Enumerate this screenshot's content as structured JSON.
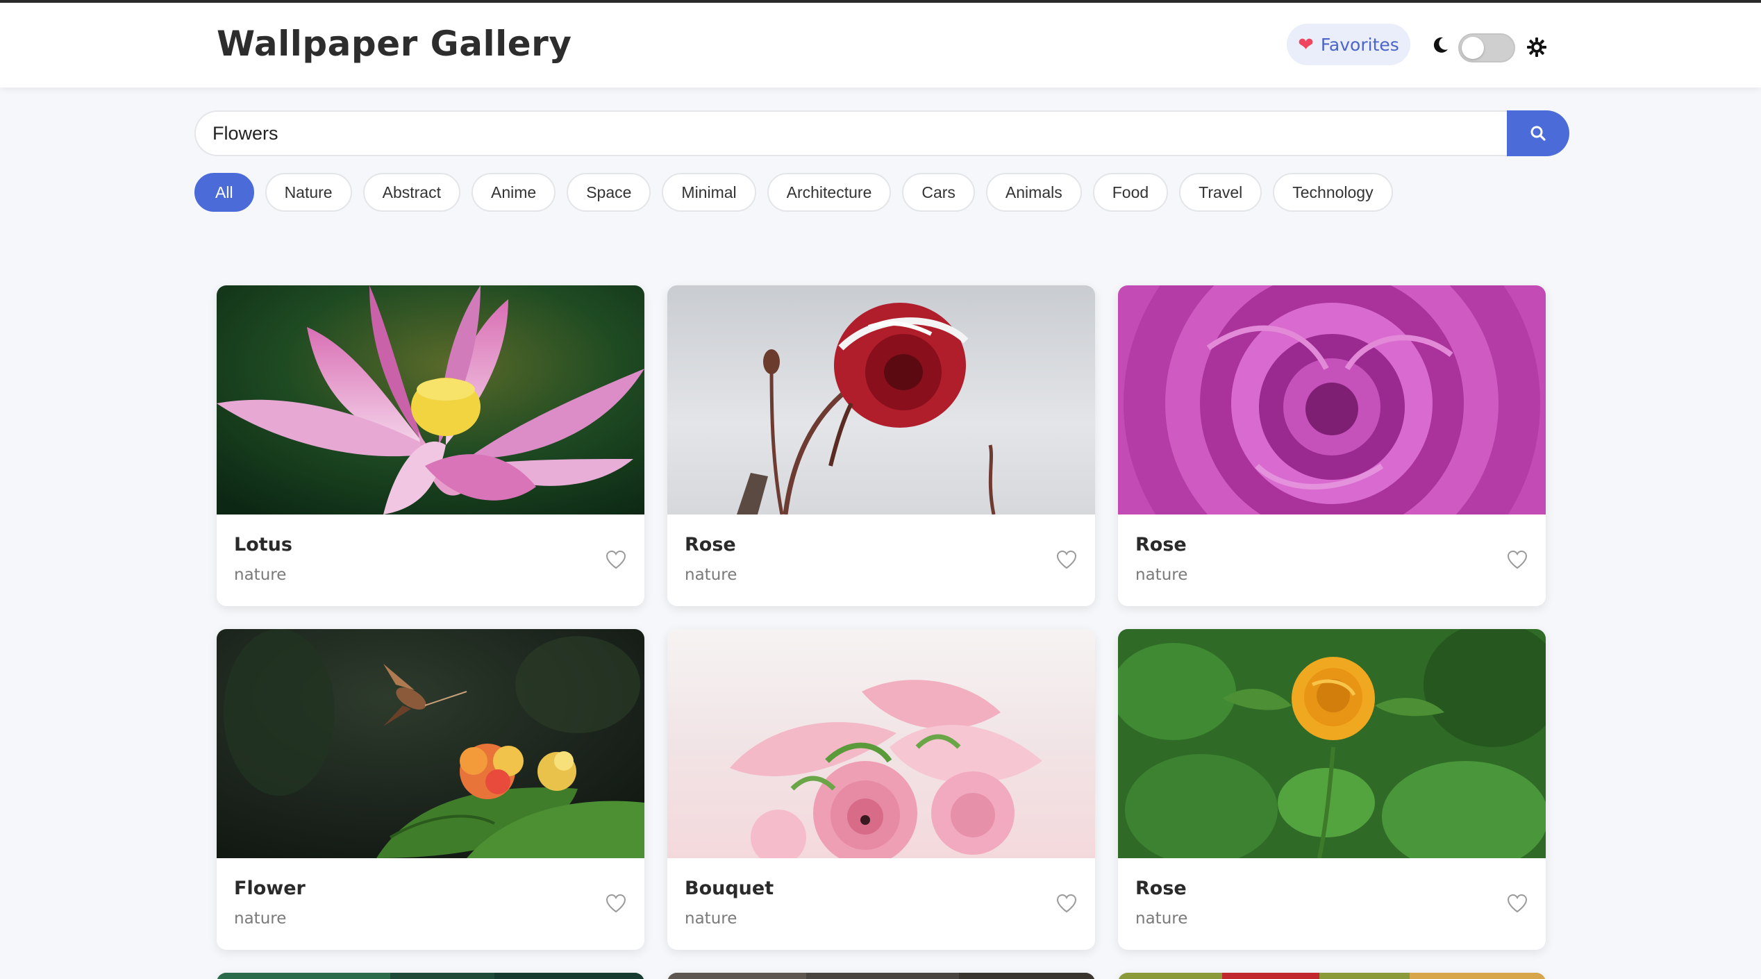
{
  "header": {
    "title": "Wallpaper Gallery",
    "favorites_label": "Favorites"
  },
  "search": {
    "value": "Flowers"
  },
  "filters": [
    "All",
    "Nature",
    "Abstract",
    "Anime",
    "Space",
    "Minimal",
    "Architecture",
    "Cars",
    "Animals",
    "Food",
    "Travel",
    "Technology"
  ],
  "active_filter": "All",
  "theme": {
    "mode": "light",
    "accent": "#4b6bd9"
  },
  "cards": [
    {
      "title": "Lotus",
      "category": "nature",
      "image": "pink lotus flower"
    },
    {
      "title": "Rose",
      "category": "nature",
      "image": "red rose with snow"
    },
    {
      "title": "Rose",
      "category": "nature",
      "image": "magenta rose close-up"
    },
    {
      "title": "Flower",
      "category": "nature",
      "image": "hummingbird moth and lantana"
    },
    {
      "title": "Bouquet",
      "category": "nature",
      "image": "pink ranunculus bouquet"
    },
    {
      "title": "Rose",
      "category": "nature",
      "image": "yellow rose on green"
    }
  ]
}
